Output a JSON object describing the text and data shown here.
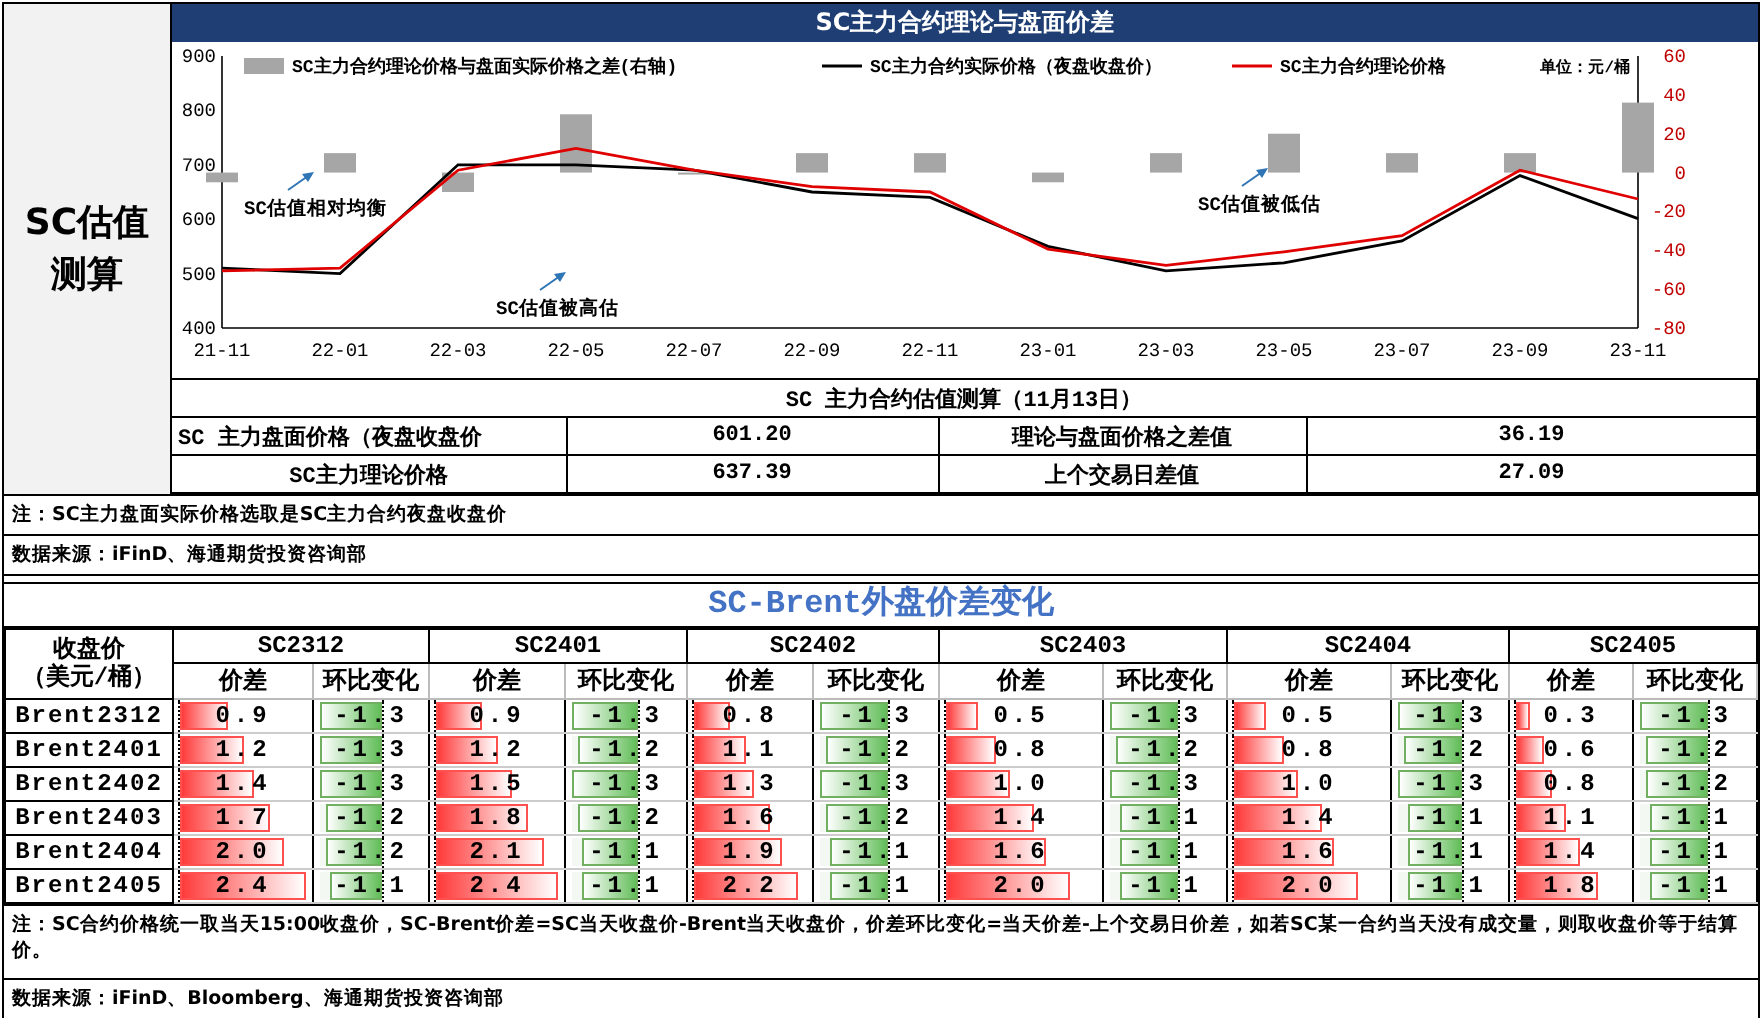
{
  "side_label": "SC估值测算",
  "chart_panel": {
    "title": "SC主力合约理论与盘面价差",
    "unit": "单位：元/桶",
    "chart_data": {
      "type": "line",
      "x": [
        "21-11",
        "22-01",
        "22-03",
        "22-05",
        "22-07",
        "22-09",
        "22-11",
        "23-01",
        "23-03",
        "23-05",
        "23-07",
        "23-09",
        "23-11"
      ],
      "series": [
        {
          "name": "SC主力合约理论价格与盘面实际价格之差(右轴)",
          "color": "#a6a6a6",
          "type": "bar",
          "axis": "y2",
          "values": [
            -5,
            10,
            -10,
            30,
            0,
            10,
            10,
            -5,
            10,
            20,
            10,
            10,
            36
          ]
        },
        {
          "name": "SC主力合约实际价格（夜盘收盘价）",
          "color": "#000000",
          "values": [
            510,
            500,
            700,
            700,
            690,
            650,
            640,
            550,
            505,
            520,
            560,
            680,
            601
          ]
        },
        {
          "name": "SC主力合约理论价格",
          "color": "#e00000",
          "values": [
            505,
            510,
            690,
            730,
            690,
            660,
            650,
            545,
            515,
            540,
            570,
            690,
            637
          ]
        }
      ],
      "ylim": [
        400,
        900
      ],
      "yticks": [
        400,
        500,
        600,
        700,
        800,
        900
      ],
      "y2lim": [
        -80,
        60
      ],
      "y2ticks": [
        -80,
        -60,
        -40,
        -20,
        0,
        20,
        40,
        60
      ],
      "legend": "top",
      "annotations": [
        "SC估值相对均衡",
        "SC估值被高估",
        "SC估值被低估"
      ]
    }
  },
  "estimate_table": {
    "title": "SC 主力合约估值测算（11月13日）",
    "rows": [
      [
        "SC 主力盘面价格（夜盘收盘价",
        "601.20",
        "理论与盘面价格之差值",
        "36.19"
      ],
      [
        "SC主力理论价格",
        "637.39",
        "上个交易日差值",
        "27.09"
      ]
    ]
  },
  "note": "注：SC主力盘面实际价格选取是SC主力合约夜盘收盘价",
  "source": "数据来源：iFinD、海通期货投资咨询部",
  "spread_section": {
    "title": "SC-Brent外盘价差变化",
    "corner_header": [
      "收盘价",
      "（美元/桶）"
    ],
    "contracts": [
      {
        "name": "SC2312",
        "spread_label": "价差",
        "change_label": "环比变化"
      },
      {
        "name": "SC2401",
        "spread_label": "价差",
        "change_label": "环比变化"
      },
      {
        "name": "SC2402",
        "spread_label": "价差",
        "change_label": "环比变化"
      },
      {
        "name": "SC2403",
        "spread_label": "价差",
        "change_label": "环比变化"
      },
      {
        "name": "SC2404",
        "spread_label": "价差",
        "change_label": "环比变化"
      },
      {
        "name": "SC2405",
        "spread_label": "价差",
        "change_label": "环比变化"
      }
    ],
    "rows": [
      {
        "label": "Brent2312",
        "cells": [
          {
            "spread": {
              "value": "0.9",
              "level": 0.38
            },
            "change": {
              "value": "-1.3",
              "level": 1
            }
          },
          {
            "spread": {
              "value": "0.9",
              "level": 0.38
            },
            "change": {
              "value": "-1.3",
              "level": 1
            }
          },
          {
            "spread": {
              "value": "0.8",
              "level": 0.33
            },
            "change": {
              "value": "-1.3",
              "level": 1
            }
          },
          {
            "spread": {
              "value": "0.5",
              "level": 0.21
            },
            "change": {
              "value": "-1.3",
              "level": 1
            }
          },
          {
            "spread": {
              "value": "0.5",
              "level": 0.21
            },
            "change": {
              "value": "-1.3",
              "level": 1
            }
          },
          {
            "spread": {
              "value": "0.3",
              "level": 0.13
            },
            "change": {
              "value": "-1.3",
              "level": 1
            }
          }
        ]
      },
      {
        "label": "Brent2401",
        "cells": [
          {
            "spread": {
              "value": "1.2",
              "level": 0.5
            },
            "change": {
              "value": "-1.3",
              "level": 1
            }
          },
          {
            "spread": {
              "value": "1.2",
              "level": 0.5
            },
            "change": {
              "value": "-1.2",
              "level": 0.92
            }
          },
          {
            "spread": {
              "value": "1.1",
              "level": 0.46
            },
            "change": {
              "value": "-1.2",
              "level": 0.92
            }
          },
          {
            "spread": {
              "value": "0.8",
              "level": 0.33
            },
            "change": {
              "value": "-1.2",
              "level": 0.92
            }
          },
          {
            "spread": {
              "value": "0.8",
              "level": 0.33
            },
            "change": {
              "value": "-1.2",
              "level": 0.92
            }
          },
          {
            "spread": {
              "value": "0.6",
              "level": 0.25
            },
            "change": {
              "value": "-1.2",
              "level": 0.92
            }
          }
        ]
      },
      {
        "label": "Brent2402",
        "cells": [
          {
            "spread": {
              "value": "1.4",
              "level": 0.58
            },
            "change": {
              "value": "-1.3",
              "level": 1
            }
          },
          {
            "spread": {
              "value": "1.5",
              "level": 0.63
            },
            "change": {
              "value": "-1.3",
              "level": 1
            }
          },
          {
            "spread": {
              "value": "1.3",
              "level": 0.54
            },
            "change": {
              "value": "-1.3",
              "level": 1
            }
          },
          {
            "spread": {
              "value": "1.0",
              "level": 0.42
            },
            "change": {
              "value": "-1.3",
              "level": 1
            }
          },
          {
            "spread": {
              "value": "1.0",
              "level": 0.42
            },
            "change": {
              "value": "-1.3",
              "level": 1
            }
          },
          {
            "spread": {
              "value": "0.8",
              "level": 0.33
            },
            "change": {
              "value": "-1.2",
              "level": 0.92
            }
          }
        ]
      },
      {
        "label": "Brent2403",
        "cells": [
          {
            "spread": {
              "value": "1.7",
              "level": 0.71
            },
            "change": {
              "value": "-1.2",
              "level": 0.92
            }
          },
          {
            "spread": {
              "value": "1.8",
              "level": 0.75
            },
            "change": {
              "value": "-1.2",
              "level": 0.92
            }
          },
          {
            "spread": {
              "value": "1.6",
              "level": 0.67
            },
            "change": {
              "value": "-1.2",
              "level": 0.92
            }
          },
          {
            "spread": {
              "value": "1.4",
              "level": 0.58
            },
            "change": {
              "value": "-1.1",
              "level": 0.85
            }
          },
          {
            "spread": {
              "value": "1.4",
              "level": 0.58
            },
            "change": {
              "value": "-1.1",
              "level": 0.85
            }
          },
          {
            "spread": {
              "value": "1.1",
              "level": 0.46
            },
            "change": {
              "value": "-1.1",
              "level": 0.85
            }
          }
        ]
      },
      {
        "label": "Brent2404",
        "cells": [
          {
            "spread": {
              "value": "2.0",
              "level": 0.83
            },
            "change": {
              "value": "-1.2",
              "level": 0.92
            }
          },
          {
            "spread": {
              "value": "2.1",
              "level": 0.88
            },
            "change": {
              "value": "-1.1",
              "level": 0.85
            }
          },
          {
            "spread": {
              "value": "1.9",
              "level": 0.79
            },
            "change": {
              "value": "-1.1",
              "level": 0.85
            }
          },
          {
            "spread": {
              "value": "1.6",
              "level": 0.67
            },
            "change": {
              "value": "-1.1",
              "level": 0.85
            }
          },
          {
            "spread": {
              "value": "1.6",
              "level": 0.67
            },
            "change": {
              "value": "-1.1",
              "level": 0.85
            }
          },
          {
            "spread": {
              "value": "1.4",
              "level": 0.58
            },
            "change": {
              "value": "-1.1",
              "level": 0.85
            }
          }
        ]
      },
      {
        "label": "Brent2405",
        "cells": [
          {
            "spread": {
              "value": "2.4",
              "level": 1
            },
            "change": {
              "value": "-1.1",
              "level": 0.85
            }
          },
          {
            "spread": {
              "value": "2.4",
              "level": 1
            },
            "change": {
              "value": "-1.1",
              "level": 0.85
            }
          },
          {
            "spread": {
              "value": "2.2",
              "level": 0.92
            },
            "change": {
              "value": "-1.1",
              "level": 0.85
            }
          },
          {
            "spread": {
              "value": "2.0",
              "level": 0.83
            },
            "change": {
              "value": "-1.1",
              "level": 0.85
            }
          },
          {
            "spread": {
              "value": "2.0",
              "level": 0.83
            },
            "change": {
              "value": "-1.1",
              "level": 0.85
            }
          },
          {
            "spread": {
              "value": "1.8",
              "level": 0.75
            },
            "change": {
              "value": "-1.1",
              "level": 0.85
            }
          }
        ]
      }
    ],
    "note": "注：SC合约价格统一取当天15:00收盘价，SC-Brent价差=SC当天收盘价-Brent当天收盘价，价差环比变化=当天价差-上个交易日价差，如若SC某一合约当天没有成交量，则取收盘价等于结算价。",
    "source": "数据来源：iFinD、Bloomberg、海通期货投资咨询部"
  }
}
